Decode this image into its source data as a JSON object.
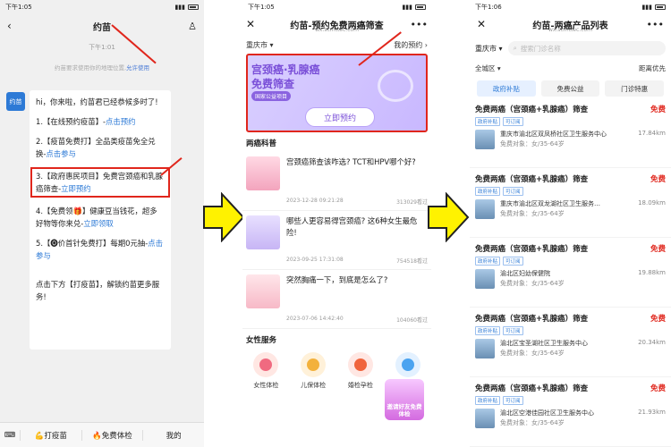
{
  "panel1": {
    "status_time": "下午1:05",
    "title": "约苗",
    "chat_time": "下午1:01",
    "notice": "约苗要求使用你的地理位置,",
    "notice_link": "允许使用",
    "avatar": "约苗",
    "greeting": "hi，你来啦，约苗君已经恭候多时了!",
    "item1_text": "1.【在线预约疫苗】-",
    "item1_link": "点击预约",
    "item2_text": "2.【疫苗免费打】全品类疫苗免全兑换-",
    "item2_link": "点击参与",
    "item3_text": "3.【政府惠民项目】免费宫颈癌和乳腺癌筛查-",
    "item3_link": "立即预约",
    "item4_text": "4.【免费领🎁】健康豆当钱花，超多好物等你来兑-",
    "item4_link": "立即领取",
    "item5_text": "5.【🅞价首针免费打】每期0元抽-",
    "item5_link": "点击参与",
    "footer_text": "点击下方【打疫苗】，解锁约苗更多服务!",
    "bottom_tabs": [
      "💪打疫苗",
      "🔥免费体检",
      "我的"
    ]
  },
  "panel2": {
    "status_time": "下午1:05",
    "title": "约苗-预约免费两癌筛查",
    "url": "wx.scmttec.com",
    "city": "重庆市",
    "my_booking": "我的预约",
    "banner_line1": "宫颈癌·乳腺癌",
    "banner_line2": "免费筛查",
    "banner_tag": "国家公益项目",
    "banner_button": "立即预约",
    "section_title": "两癌科普",
    "articles": [
      {
        "title": "宫颈癌筛查该咋选? TCT和HPV哪个好?",
        "date": "2023-12-28 09:21:28",
        "views": "313029看过"
      },
      {
        "title": "哪些人更容易得宫颈癌? 这6种女生最危险!",
        "date": "2023-09-25 17:31:08",
        "views": "754518看过"
      },
      {
        "title": "突然胸痛一下，到底是怎么了?",
        "date": "2023-07-06 14:42:40",
        "views": "104060看过"
      }
    ],
    "services_title": "女性服务",
    "services": [
      "女性体检",
      "儿保体检",
      "婚检孕检"
    ],
    "promo": "邀请好友免费体检"
  },
  "panel3": {
    "status_time": "下午1:06",
    "title": "约苗-两癌产品列表",
    "url": "wx.scmttec.com",
    "city": "重庆市",
    "search_placeholder": "搜索门诊名称",
    "filter_left": "全城区",
    "filter_right": "距离优先",
    "tabs": [
      "政府补贴",
      "免费公益",
      "门诊特惠"
    ],
    "cards": [
      {
        "title": "免费两癌（宫颈癌+乳腺癌）筛查",
        "price": "免费",
        "badges": [
          "政府补贴",
          "可订阅"
        ],
        "clinic": "重庆市渝北区双凤桥社区卫生服务中心",
        "target": "免费对象：女/35-64岁",
        "distance": "17.84km"
      },
      {
        "title": "免费两癌（宫颈癌+乳腺癌）筛查",
        "price": "免费",
        "badges": [
          "政府补贴",
          "可订阅"
        ],
        "clinic": "重庆市渝北区双龙湖社区卫生服务…",
        "target": "免费对象：女/35-64岁",
        "distance": "18.09km"
      },
      {
        "title": "免费两癌（宫颈癌+乳腺癌）筛查",
        "price": "免费",
        "badges": [
          "政府补贴",
          "可订阅"
        ],
        "clinic": "渝北区妇幼保健院",
        "target": "免费对象：女/35-64岁",
        "distance": "19.88km"
      },
      {
        "title": "免费两癌（宫颈癌+乳腺癌）筛查",
        "price": "免费",
        "badges": [
          "政府补贴",
          "可订阅"
        ],
        "clinic": "渝北区宝圣湖社区卫生服务中心",
        "target": "免费对象：女/35-64岁",
        "distance": "20.34km"
      },
      {
        "title": "免费两癌（宫颈癌+乳腺癌）筛查",
        "price": "免费",
        "badges": [
          "政府补贴",
          "可订阅"
        ],
        "clinic": "渝北区空港佳园社区卫生服务中心",
        "target": "免费对象：女/35-64岁",
        "distance": "21.93km"
      }
    ]
  }
}
